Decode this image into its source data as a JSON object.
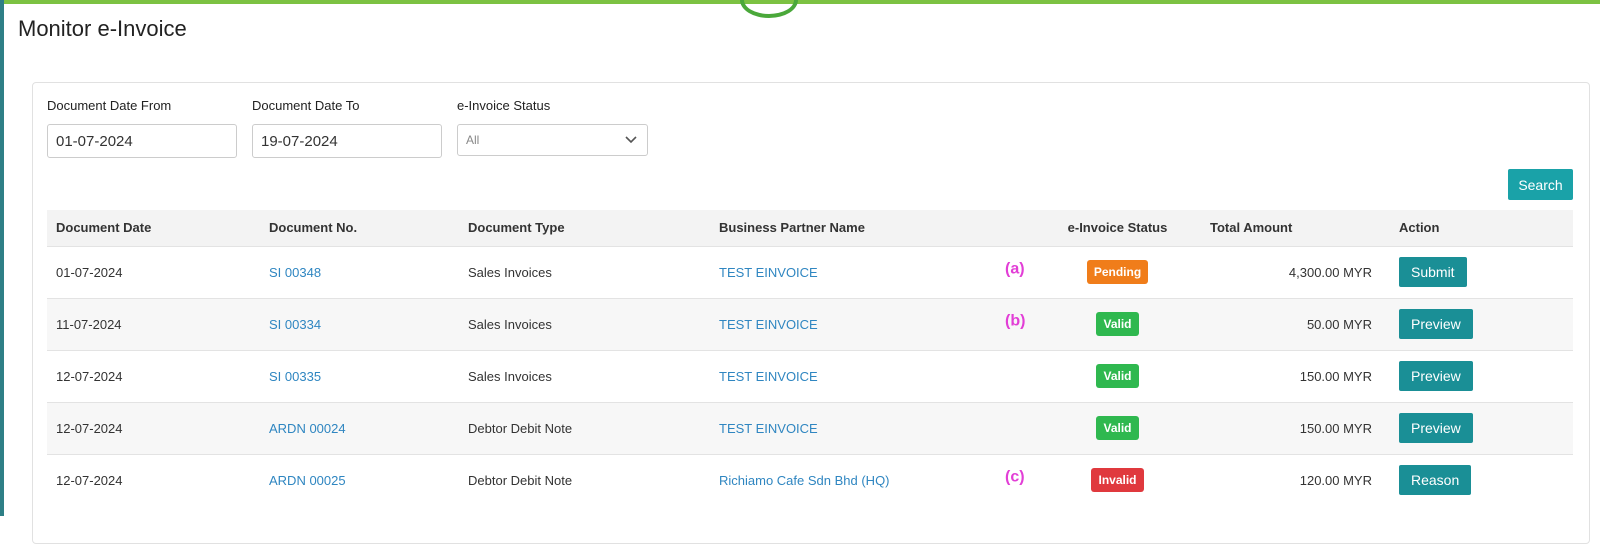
{
  "page": {
    "title": "Monitor e-Invoice"
  },
  "filters": {
    "date_from": {
      "label": "Document Date From",
      "value": "01-07-2024"
    },
    "date_to": {
      "label": "Document Date To",
      "value": "19-07-2024"
    },
    "status": {
      "label": "e-Invoice Status",
      "value": "All"
    },
    "search_label": "Search"
  },
  "table": {
    "headers": [
      "Document Date",
      "Document No.",
      "Document Type",
      "Business Partner Name",
      "e-Invoice Status",
      "Total Amount",
      "Action"
    ],
    "rows": [
      {
        "date": "01-07-2024",
        "doc_no": "SI 00348",
        "type": "Sales Invoices",
        "partner": "TEST EINVOICE",
        "marker": "(a)",
        "status": "Pending",
        "status_color": "#f07d1a",
        "amount": "4,300.00 MYR",
        "action": "Submit"
      },
      {
        "date": "11-07-2024",
        "doc_no": "SI 00334",
        "type": "Sales Invoices",
        "partner": "TEST EINVOICE",
        "marker": "(b)",
        "status": "Valid",
        "status_color": "#2fb84f",
        "amount": "50.00 MYR",
        "action": "Preview"
      },
      {
        "date": "12-07-2024",
        "doc_no": "SI 00335",
        "type": "Sales Invoices",
        "partner": "TEST EINVOICE",
        "marker": "",
        "status": "Valid",
        "status_color": "#2fb84f",
        "amount": "150.00 MYR",
        "action": "Preview"
      },
      {
        "date": "12-07-2024",
        "doc_no": "ARDN 00024",
        "type": "Debtor Debit Note",
        "partner": "TEST EINVOICE",
        "marker": "",
        "status": "Valid",
        "status_color": "#2fb84f",
        "amount": "150.00 MYR",
        "action": "Preview"
      },
      {
        "date": "12-07-2024",
        "doc_no": "ARDN 00025",
        "type": "Debtor Debit Note",
        "partner": "Richiamo Cafe Sdn Bhd (HQ)",
        "marker": "(c)",
        "status": "Invalid",
        "status_color": "#e0393e",
        "amount": "120.00 MYR",
        "action": "Reason"
      }
    ]
  },
  "colors": {
    "accent": "#1aa2a8",
    "action_button": "#1a8f96",
    "link": "#2f86c1",
    "marker": "#e23ed6",
    "top_bar": "#7cc242"
  }
}
